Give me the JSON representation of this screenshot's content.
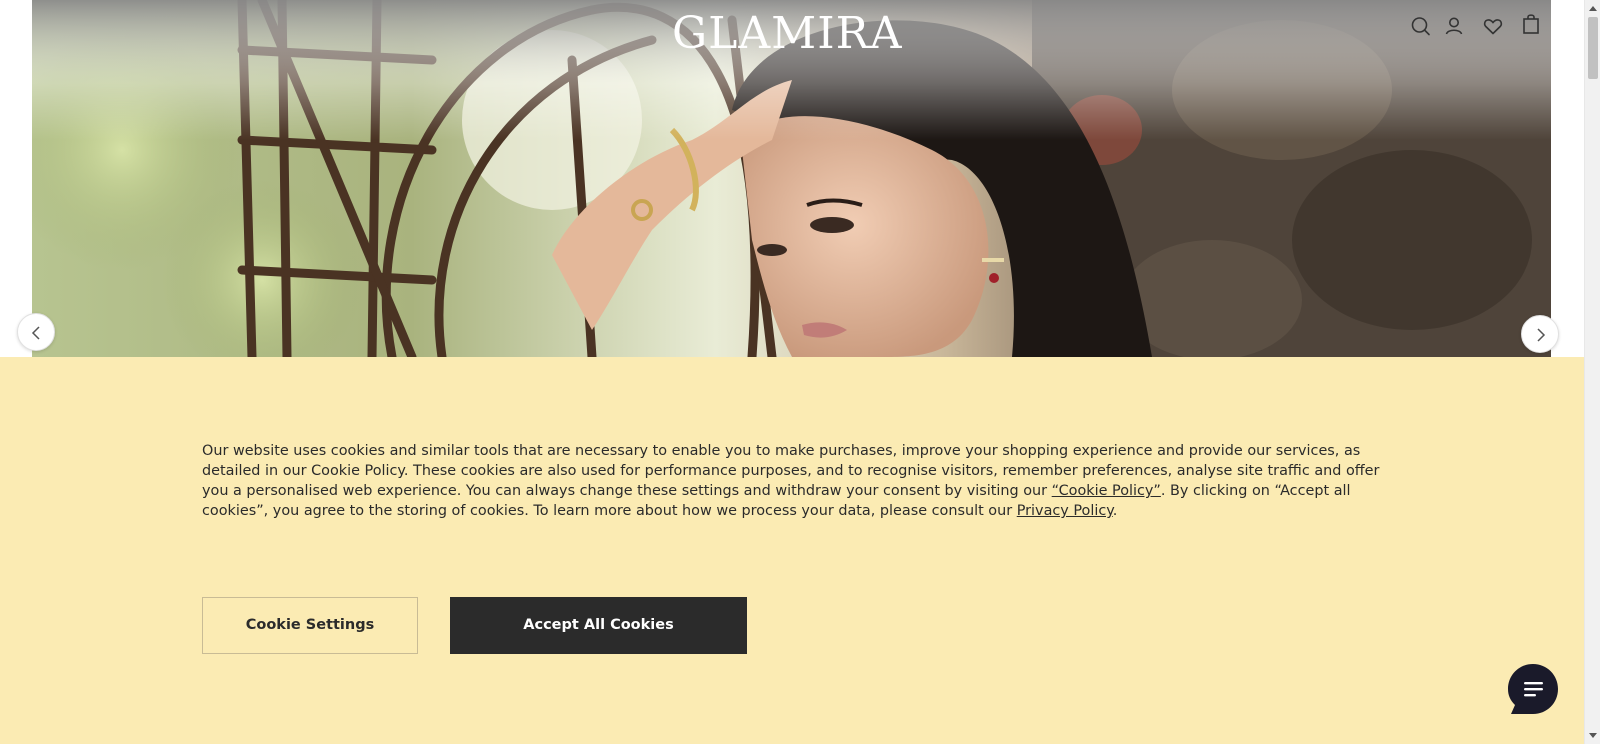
{
  "header": {
    "logo": "GLAMIRA",
    "icons": [
      "search-icon",
      "account-icon",
      "wishlist-heart-icon",
      "shopping-bag-icon"
    ]
  },
  "hero": {
    "image": "model-with-earrings-and-bracelet",
    "prev_icon": "chevron-left-icon",
    "next_icon": "chevron-right-icon"
  },
  "cookie_banner": {
    "text_part1": "Our website uses cookies and similar tools that are necessary to enable you to make purchases, improve your shopping experience and provide our services, as detailed in our Cookie Policy. These cookies are also used for performance purposes, and to recognise visitors, remember preferences, analyse site traffic and offer you a personalised web experience. You can always change these settings and withdraw your consent by visiting our ",
    "cookie_policy_link": "“Cookie Policy”",
    "text_part2": ". By clicking on “Accept all cookies”, you agree to the storing of cookies. To learn more about how we process your data, please consult our ",
    "privacy_policy_link": "Privacy Policy",
    "text_part3": ".",
    "settings_button": "Cookie Settings",
    "accept_button": "Accept All Cookies",
    "background_color": "#fbebb3"
  },
  "chat": {
    "icon": "chat-bubble-icon"
  }
}
